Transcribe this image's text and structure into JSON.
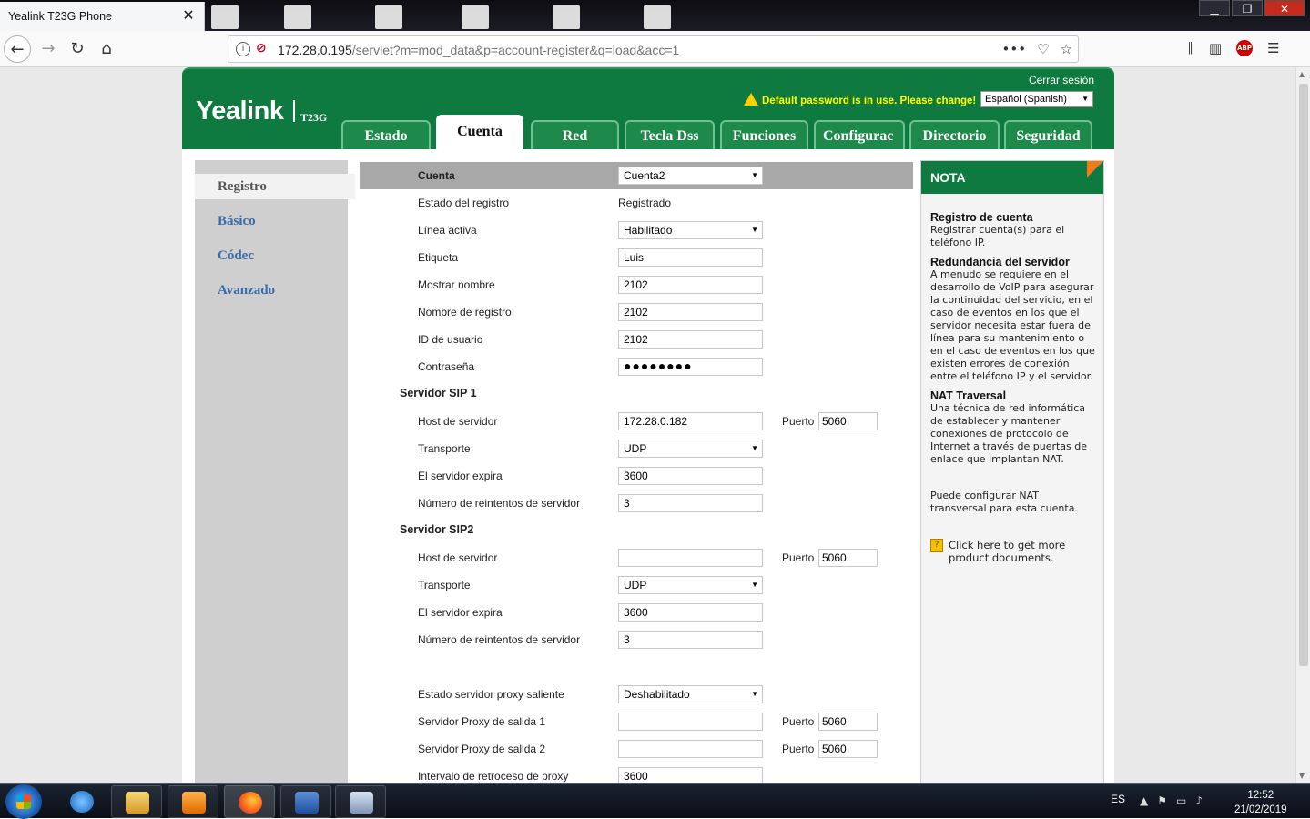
{
  "browser": {
    "tab_title": "Yealink T23G Phone",
    "tab_close": "✕",
    "url_host": "172.28.0.195",
    "url_path": "/servlet?m=mod_data&p=account-register&q=load&acc=1"
  },
  "header": {
    "logo": "Yealink",
    "model": "T23G",
    "logout": "Cerrar sesión",
    "warning": "Default password is in use. Please change!",
    "language": "Español (Spanish)"
  },
  "tabs": [
    {
      "label": "Estado"
    },
    {
      "label": "Cuenta"
    },
    {
      "label": "Red"
    },
    {
      "label": "Tecla Dss"
    },
    {
      "label": "Funciones"
    },
    {
      "label": "Configurac"
    },
    {
      "label": "Directorio"
    },
    {
      "label": "Seguridad"
    }
  ],
  "sidebar": {
    "items": [
      {
        "label": "Registro"
      },
      {
        "label": "Básico"
      },
      {
        "label": "Códec"
      },
      {
        "label": "Avanzado"
      }
    ]
  },
  "form": {
    "account_label": "Cuenta",
    "account_value": "Cuenta2",
    "status_label": "Estado del registro",
    "status_value": "Registrado",
    "line_label": "Línea activa",
    "line_value": "Habilitado",
    "tag_label": "Etiqueta",
    "tag_value": "Luis",
    "display_label": "Mostrar nombre",
    "display_value": "2102",
    "regname_label": "Nombre de registro",
    "regname_value": "2102",
    "userid_label": "ID de usuario",
    "userid_value": "2102",
    "password_label": "Contraseña",
    "password_value": "●●●●●●●●",
    "sip1_title": "Servidor SIP 1",
    "sip1_host_label": "Host de servidor",
    "sip1_host_value": "172.28.0.182",
    "sip1_port_label": "Puerto",
    "sip1_port_value": "5060",
    "sip1_transport_label": "Transporte",
    "sip1_transport_value": "UDP",
    "sip1_expires_label": "El servidor expira",
    "sip1_expires_value": "3600",
    "sip1_retry_label": "Número de reintentos de servidor",
    "sip1_retry_value": "3",
    "sip2_title": "Servidor SIP2",
    "sip2_host_label": "Host de servidor",
    "sip2_host_value": "",
    "sip2_port_label": "Puerto",
    "sip2_port_value": "5060",
    "sip2_transport_label": "Transporte",
    "sip2_transport_value": "UDP",
    "sip2_expires_label": "El servidor expira",
    "sip2_expires_value": "3600",
    "sip2_retry_label": "Número de reintentos de servidor",
    "sip2_retry_value": "3",
    "proxy_state_label": "Estado servidor proxy saliente",
    "proxy_state_value": "Deshabilitado",
    "proxy1_label": "Servidor Proxy de salida 1",
    "proxy1_value": "",
    "proxy1_port_label": "Puerto",
    "proxy1_port_value": "5060",
    "proxy2_label": "Servidor Proxy de salida 2",
    "proxy2_value": "",
    "proxy2_port_label": "Puerto",
    "proxy2_port_value": "5060",
    "fallback_label": "Intervalo de retroceso de proxy",
    "fallback_value": "3600"
  },
  "note": {
    "title": "NOTA",
    "s1_title": "Registro de cuenta",
    "s1_text": "Registrar cuenta(s) para el teléfono IP.",
    "s2_title": "Redundancia del servidor",
    "s2_text": "A menudo se requiere en el desarrollo de VoIP para asegurar la continuidad del servicio, en el caso de eventos en los que el servidor necesita estar fuera de línea para su mantenimiento o en el caso de eventos en los que existen errores de conexión entre el teléfono IP y el servidor.",
    "s3_title": "NAT Traversal",
    "s3_text": "Una técnica de red informática de establecer y mantener conexiones de protocolo de Internet a través de puertas de enlace que implantan NAT.",
    "s4_text": "Puede configurar NAT transversal para esta cuenta.",
    "link_text": "Click here to get more product documents."
  },
  "taskbar": {
    "lang": "ES",
    "time": "12:52",
    "date": "21/02/2019"
  },
  "colors": {
    "brand_green": "#0e7a3f",
    "warning_yellow": "#ffff00",
    "sidebar_link": "#3a6ba8",
    "note_corner": "#f27a1a"
  }
}
